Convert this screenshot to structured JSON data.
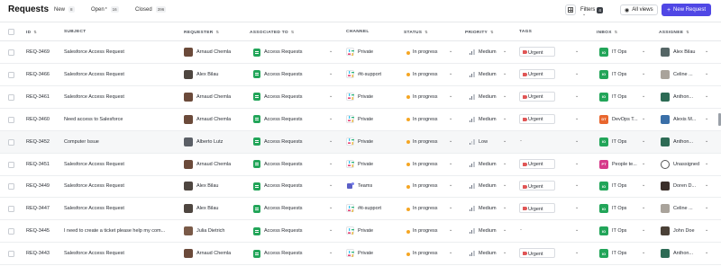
{
  "header": {
    "title": "Requests",
    "tabs": [
      {
        "label": "New",
        "count": "8"
      },
      {
        "label": "Open",
        "marker": "*",
        "count": "16"
      },
      {
        "label": "Closed",
        "count": "396"
      }
    ],
    "filters_label": "Filters",
    "filters_count": "4",
    "views_label": "All views",
    "new_button": "New Request"
  },
  "columns": [
    "ID",
    "SUBJECT",
    "REQUESTER",
    "ASSOCIATED TO",
    "CHANNEL",
    "STATUS",
    "PRIORITY",
    "TAGS",
    "INBOX",
    "ASSIGNEE"
  ],
  "rows": [
    {
      "id": "REQ-3469",
      "subject": "Salesforce Access Request",
      "requester": "Arnaud Chemla",
      "assoc": "Access Requests",
      "channel": "Private",
      "status": "In progress",
      "priority": "Medium",
      "tag": "Urgent",
      "inbox_badge": "IO",
      "inbox": "IT Ops",
      "assignee": "Alex Bilau"
    },
    {
      "id": "REQ-3466",
      "subject": "Salesforce Access Request",
      "requester": "Alex Bilau",
      "assoc": "Access Requests",
      "channel": "#it-support",
      "status": "In progress",
      "priority": "Medium",
      "tag": "Urgent",
      "inbox_badge": "IO",
      "inbox": "IT Ops",
      "assignee": "Celine ..."
    },
    {
      "id": "REQ-3461",
      "subject": "Salesforce Access Request",
      "requester": "Arnaud Chemla",
      "assoc": "Access Requests",
      "channel": "Private",
      "status": "In progress",
      "priority": "Medium",
      "tag": "Urgent",
      "inbox_badge": "IO",
      "inbox": "IT Ops",
      "assignee": "Anthon..."
    },
    {
      "id": "REQ-3460",
      "subject": "Need access to Salesforce",
      "requester": "Arnaud Chemla",
      "assoc": "Access Requests",
      "channel": "Private",
      "status": "In progress",
      "priority": "Medium",
      "tag": "Urgent",
      "inbox_badge": "DT",
      "inbox": "DevOps T...",
      "assignee": "Alexis M..."
    },
    {
      "id": "REQ-3452",
      "subject": "Computer Issue",
      "requester": "Alberto Lutz",
      "assoc": "Access Requests",
      "channel": "Private",
      "status": "In progress",
      "priority": "Low",
      "tag": "-",
      "inbox_badge": "IO",
      "inbox": "IT Ops",
      "assignee": "Anthon..."
    },
    {
      "id": "REQ-3451",
      "subject": "Salesforce Access Request",
      "requester": "Arnaud Chemla",
      "assoc": "Access Requests",
      "channel": "Private",
      "status": "In progress",
      "priority": "Medium",
      "tag": "Urgent",
      "inbox_badge": "PT",
      "inbox": "People te...",
      "assignee": "Unassigned"
    },
    {
      "id": "REQ-3449",
      "subject": "Salesforce Access Request",
      "requester": "Alex Bilau",
      "assoc": "Access Requests",
      "channel": "Teams",
      "status": "In progress",
      "priority": "Medium",
      "tag": "Urgent",
      "inbox_badge": "IO",
      "inbox": "IT Ops",
      "assignee": "Doren D..."
    },
    {
      "id": "REQ-3447",
      "subject": "Salesforce Access Request",
      "requester": "Alex Bilau",
      "assoc": "Access Requests",
      "channel": "#it-support",
      "status": "In progress",
      "priority": "Medium",
      "tag": "Urgent",
      "inbox_badge": "IO",
      "inbox": "IT Ops",
      "assignee": "Celine ..."
    },
    {
      "id": "REQ-3445",
      "subject": "I need to create a ticket please help my com...",
      "requester": "Julia Dietrich",
      "assoc": "Access Requests",
      "channel": "Private",
      "status": "In progress",
      "priority": "Medium",
      "tag": "-",
      "inbox_badge": "IO",
      "inbox": "IT Ops",
      "assignee": "John Doe"
    },
    {
      "id": "REQ-3443",
      "subject": "Salesforce Access Request",
      "requester": "Arnaud Chemla",
      "assoc": "Access Requests",
      "channel": "Private",
      "status": "In progress",
      "priority": "Medium",
      "tag": "Urgent",
      "inbox_badge": "IO",
      "inbox": "IT Ops",
      "assignee": "Anthon..."
    }
  ],
  "colors": {
    "accent": "#5047e5",
    "status_dot": "#f5a623",
    "urgent_tag": "#e05656",
    "inbox_it_ops": "#22a559",
    "inbox_devops": "#e8662e",
    "inbox_people": "#d63a8a",
    "assoc_icon": "#22a559"
  }
}
